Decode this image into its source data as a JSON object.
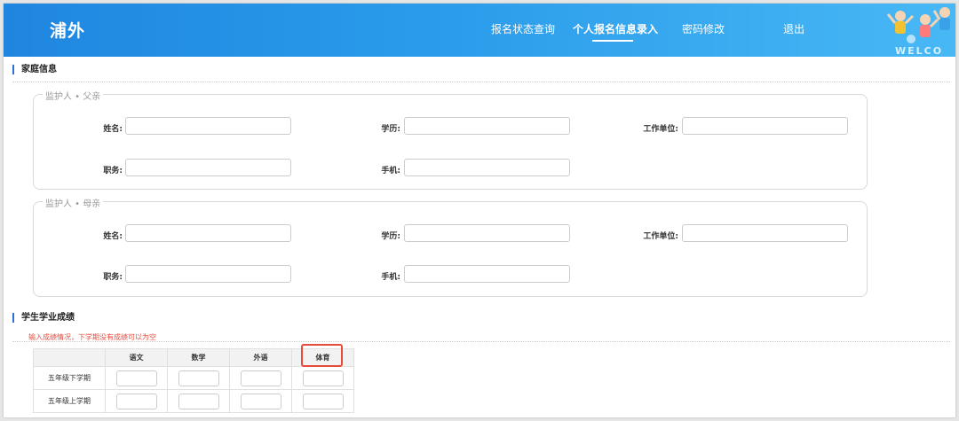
{
  "header": {
    "logo": "浦外",
    "nav": [
      {
        "label": "报名状态查询",
        "active": false
      },
      {
        "label": "个人报名信息录入",
        "active": true
      },
      {
        "label": "密码修改",
        "active": false
      },
      {
        "label": "退出",
        "active": false
      }
    ],
    "welcome": "WELCO"
  },
  "family": {
    "title": "家庭信息",
    "father": {
      "legend": "监护人 • 父亲",
      "name_label": "姓名:",
      "education_label": "学历:",
      "employer_label": "工作单位:",
      "position_label": "职务:",
      "phone_label": "手机:"
    },
    "mother": {
      "legend": "监护人 • 母亲",
      "name_label": "姓名:",
      "education_label": "学历:",
      "employer_label": "工作单位:",
      "position_label": "职务:",
      "phone_label": "手机:"
    }
  },
  "scores": {
    "title": "学生学业成绩",
    "hint": "输入成绩情况，下学期没有成绩可以为空",
    "columns": [
      "",
      "语文",
      "数学",
      "外语",
      "体育"
    ],
    "rows": [
      "五年级下学期",
      "五年级上学期"
    ]
  },
  "colors": {
    "header_start": "#1f86e0",
    "header_end": "#48b8f5",
    "hint_red": "#e84c3d",
    "highlight_red": "#e44b3b"
  }
}
